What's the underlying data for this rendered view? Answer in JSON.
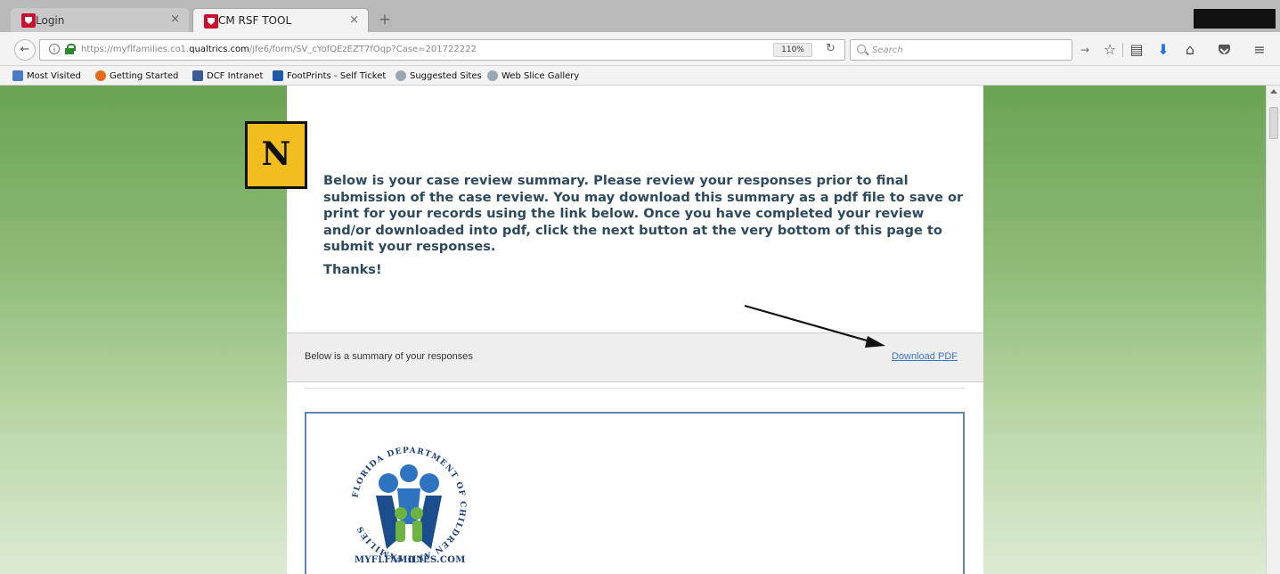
{
  "browser": {
    "tabs": [
      {
        "label": "Login",
        "active": false
      },
      {
        "label": "CM RSF TOOL",
        "active": true
      }
    ],
    "new_tab_symbol": "+",
    "close_symbol": "×",
    "url_prefix": "https://myflfamilies.co1.",
    "url_domain": "qualtrics.com",
    "url_path": "/jfe6/form/SV_cYofQEzEZT7fOqp?Case=201722222",
    "zoom": "110%",
    "search_placeholder": "Search",
    "icons": [
      "back-icon",
      "info-icon",
      "lock-icon",
      "reload-icon",
      "search-icon",
      "star-icon",
      "reading-list-icon",
      "download-icon",
      "home-icon",
      "pocket-icon",
      "menu-icon"
    ]
  },
  "bookmarks": [
    {
      "label": "Most Visited",
      "icon": "most-visited-icon"
    },
    {
      "label": "Getting Started",
      "icon": "firefox-icon"
    },
    {
      "label": "DCF Intranet",
      "icon": "dcf-icon"
    },
    {
      "label": "FootPrints - Self Ticket",
      "icon": "footprints-icon"
    },
    {
      "label": "Suggested Sites",
      "icon": "globe-icon"
    },
    {
      "label": "Web Slice Gallery",
      "icon": "globe-icon"
    }
  ],
  "page": {
    "logo_letter": "N",
    "intro": "Below is your case review summary. Please review your responses prior to final submission of the case review. You may download this summary as a pdf file to save or print for your records using the link below. Once you have completed your review and/or downloaded into pdf, click the next button at the very bottom of this page to submit your responses.",
    "thanks": "Thanks!",
    "summary_label": "Below is a summary of your responses",
    "download_link": "Download PDF",
    "seal_ring_text": "FLORIDA DEPARTMENT OF CHILDREN AND FAMILIES",
    "seal_caption": "MYFLFAMILIES.COM"
  },
  "colors": {
    "brand_green": "#6aa354",
    "heading_text": "#2e4a5e",
    "link_blue": "#3b74c8",
    "seal_blue": "#1b3f7c",
    "logo_yellow": "#f2bd1e"
  }
}
